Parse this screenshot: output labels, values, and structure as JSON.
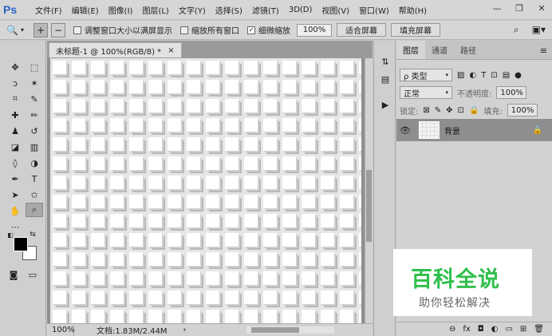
{
  "app": {
    "logo": "Ps"
  },
  "menu": [
    "文件(F)",
    "编辑(E)",
    "图像(I)",
    "图层(L)",
    "文字(Y)",
    "选择(S)",
    "滤镜(T)",
    "3D(D)",
    "视图(V)",
    "窗口(W)",
    "帮助(H)"
  ],
  "window_controls": {
    "minimize": "—",
    "restore": "❐",
    "close": "✕"
  },
  "options": {
    "tool_icon": "🔍",
    "zoom_in": "+",
    "zoom_out": "−",
    "resize_windows_label": "调整窗口大小以满屏显示",
    "zoom_all_label": "缩放所有窗口",
    "scrubby_label": "细微缩放",
    "zoom_value": "100%",
    "fit_screen": "适合屏幕",
    "fill_screen": "填充屏幕"
  },
  "document": {
    "tab_title": "未标题-1 @ 100%(RGB/8) *",
    "tab_close": "×",
    "zoom": "100%",
    "doc_info": "文档:1.83M/2.44M",
    "info_arrow": "›"
  },
  "dock": {
    "icon1": "⇅",
    "icon2": "▤",
    "play": "▶"
  },
  "layers_panel": {
    "tabs": [
      "图层",
      "通道",
      "路径"
    ],
    "menu_icon": "≡",
    "filter_label": "ρ 类型",
    "blend_mode": "正常",
    "opacity_label": "不透明度:",
    "opacity_value": "100%",
    "lock_label": "锁定:",
    "fill_label": "填充:",
    "fill_value": "100%",
    "layer_name": "背景",
    "bottom_icons": [
      "⊖",
      "fx",
      "◘",
      "◐",
      "▭",
      "⊞",
      "🗑"
    ]
  },
  "watermark": {
    "title": "百科全说",
    "subtitle": "助你轻松解决"
  }
}
